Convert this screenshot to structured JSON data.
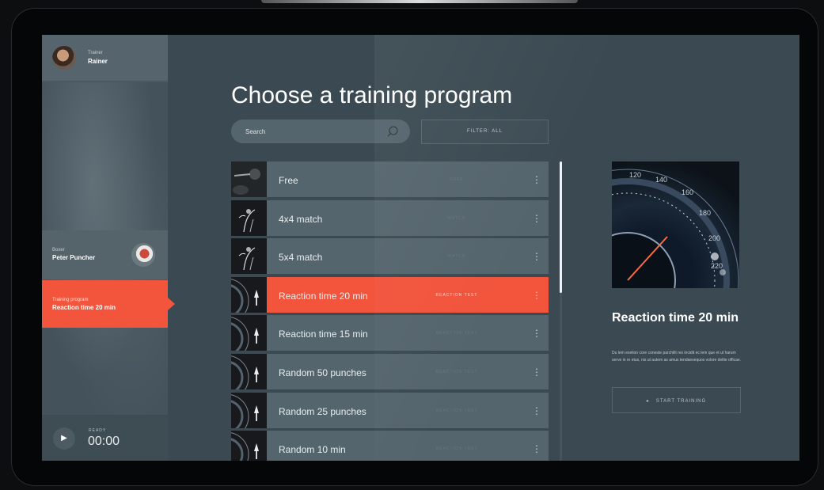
{
  "sidebar": {
    "trainer": {
      "role": "Trainer",
      "name": "Rainer"
    },
    "boxer": {
      "role": "Boxer",
      "name": "Peter Puncher"
    },
    "program": {
      "role": "Training program",
      "name": "Reaction time 20 min"
    },
    "status": {
      "label": "READY",
      "time": "00:00"
    }
  },
  "main": {
    "title": "Choose a training program",
    "search_placeholder": "Search",
    "filter_label": "FILTER: ALL",
    "programs": [
      {
        "label": "Free",
        "type": "FREE",
        "active": false,
        "thumb": "boxer-dark"
      },
      {
        "label": "4x4 match",
        "type": "MATCH",
        "active": false,
        "thumb": "boxer-light"
      },
      {
        "label": "5x4 match",
        "type": "MATCH",
        "active": false,
        "thumb": "boxer-light"
      },
      {
        "label": "Reaction time 20 min",
        "type": "REACTION TEST",
        "active": true,
        "thumb": "gauge"
      },
      {
        "label": "Reaction time 15 min",
        "type": "REACTION TEST",
        "active": false,
        "thumb": "gauge"
      },
      {
        "label": "Random 50 punches",
        "type": "REACTION TEST",
        "active": false,
        "thumb": "gauge"
      },
      {
        "label": "Random 25 punches",
        "type": "REACTION TEST",
        "active": false,
        "thumb": "gauge"
      },
      {
        "label": "Random 10 min",
        "type": "REACTION TEST",
        "active": false,
        "thumb": "gauge"
      }
    ]
  },
  "detail": {
    "title": "Reaction time 20 min",
    "description": "Du lem exelion core coneste parchilit res incidit ec lem que et ut harum serve in re etus, nis ut autem as amus tendaesequos volore delite officae.",
    "button_label": "START TRAINING",
    "gauge_numbers": [
      "120",
      "140",
      "160",
      "180",
      "200",
      "220"
    ]
  },
  "colors": {
    "accent": "#f2543c",
    "background": "#3b4a52",
    "row": "#55656d"
  }
}
